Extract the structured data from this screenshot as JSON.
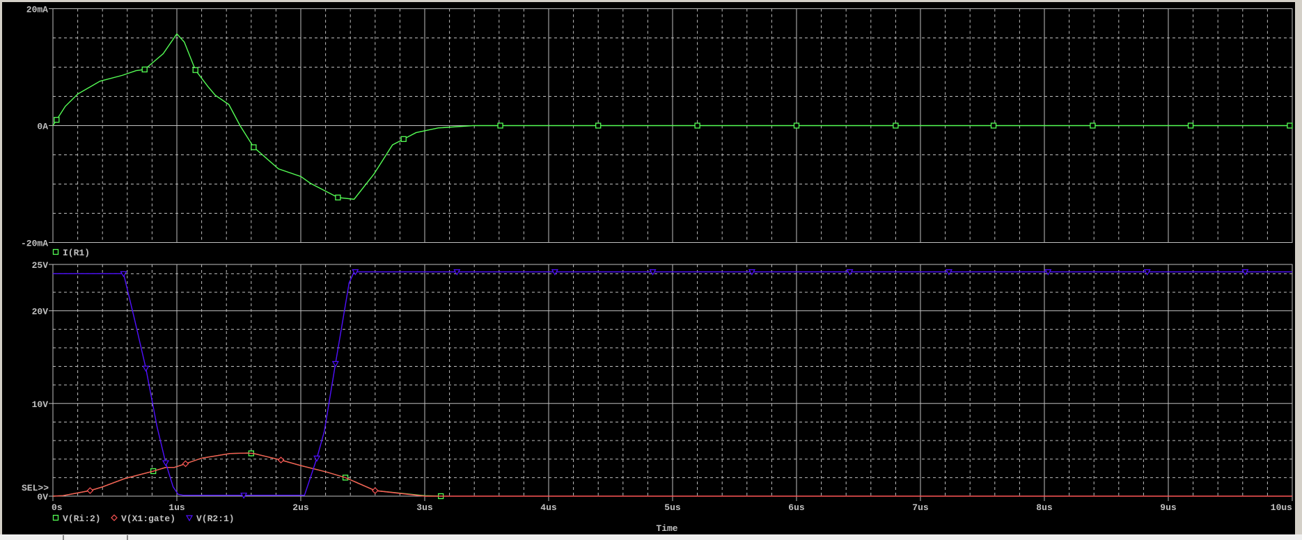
{
  "colors": {
    "background": "#000000",
    "grid": "#c0c0c0",
    "text": "#c0c0c0",
    "green": "#55ff55",
    "red": "#ff5555",
    "blue": "#5010ff"
  },
  "x_axis": {
    "label": "Time",
    "ticks": [
      "0s",
      "1us",
      "2us",
      "3us",
      "4us",
      "5us",
      "6us",
      "7us",
      "8us",
      "9us",
      "10us"
    ],
    "range": [
      0,
      10
    ],
    "unit": "us"
  },
  "chart_data": [
    {
      "type": "line",
      "title": "",
      "ylabel": "",
      "ylim": [
        -20,
        20
      ],
      "ytick_labels": [
        "20mA",
        "0A",
        "-20mA"
      ],
      "ytick_values": [
        20,
        0,
        -20
      ],
      "series": [
        {
          "name": "I(R1)",
          "color": "#55ff55",
          "marker": "square",
          "x": [
            0,
            0.1,
            0.2,
            0.38,
            0.56,
            0.67,
            0.74,
            0.89,
            1.0,
            1.06,
            1.15,
            1.25,
            1.31,
            1.42,
            1.51,
            1.62,
            1.82,
            2.0,
            2.08,
            2.3,
            2.43,
            2.59,
            2.74,
            2.83,
            2.93,
            3.11,
            3.39,
            10
          ],
          "y": [
            0,
            3.3,
            5.4,
            7.6,
            8.6,
            9.4,
            9.6,
            12.3,
            15.7,
            14.3,
            9.5,
            6.7,
            5.2,
            3.6,
            0,
            -3.7,
            -7.4,
            -8.7,
            -9.9,
            -12.3,
            -12.6,
            -8.3,
            -3.3,
            -2.3,
            -1.2,
            -0.4,
            0,
            0
          ],
          "markers_x": [
            0.03,
            0.74,
            1.15,
            1.62,
            2.3,
            2.83,
            3.61,
            4.4,
            5.2,
            6.0,
            6.8,
            7.59,
            8.39,
            9.18,
            9.98
          ]
        }
      ]
    },
    {
      "type": "line",
      "title": "",
      "ylabel": "",
      "ylim": [
        0,
        25
      ],
      "ytick_labels": [
        "25V",
        "20V",
        "10V",
        "0V"
      ],
      "ytick_values": [
        25,
        20,
        10,
        0
      ],
      "annotation": "SEL>>",
      "series": [
        {
          "name": "V(Ri:2)",
          "color": "#55ff55",
          "marker": "square",
          "x": [
            0,
            0.08,
            0.3,
            0.4,
            0.58,
            0.81,
            0.91,
            0.98,
            1.07,
            1.2,
            1.43,
            1.57,
            1.62,
            1.84,
            2.0,
            2.21,
            2.36,
            2.6,
            3.0,
            3.13
          ],
          "y": [
            0,
            0.05,
            0.6,
            1,
            1.9,
            2.7,
            3.1,
            3.1,
            3.5,
            4.1,
            4.6,
            4.65,
            4.6,
            3.9,
            3.3,
            2.6,
            2.0,
            0.6,
            0.05,
            0
          ],
          "markers_x": [
            0.81,
            1.6,
            2.36,
            3.13
          ]
        },
        {
          "name": "V(X1:gate)",
          "color": "#ff5555",
          "marker": "diamond",
          "x": [
            0,
            0.08,
            0.3,
            0.4,
            0.58,
            0.81,
            0.91,
            0.98,
            1.07,
            1.2,
            1.43,
            1.57,
            1.62,
            1.84,
            2.0,
            2.21,
            2.36,
            2.6,
            3.0,
            10
          ],
          "y": [
            0,
            0.05,
            0.6,
            1,
            1.9,
            2.7,
            3.1,
            3.1,
            3.5,
            4.1,
            4.6,
            4.65,
            4.6,
            3.9,
            3.3,
            2.6,
            2.0,
            0.6,
            0,
            0
          ],
          "markers_x": [
            0.3,
            1.07,
            1.84,
            2.6
          ]
        },
        {
          "name": "V(R2:1)",
          "color": "#5010ff",
          "marker": "triangle-down",
          "x": [
            0,
            0.57,
            0.66,
            0.75,
            0.84,
            0.91,
            0.97,
            1.01,
            1.05,
            2.03,
            2.13,
            2.19,
            2.28,
            2.39,
            2.43,
            10
          ],
          "y": [
            24,
            24,
            19,
            13.8,
            7.5,
            3.6,
            1,
            0.2,
            0.1,
            0.1,
            4.1,
            7,
            14.3,
            23,
            24.2,
            24.2
          ],
          "markers_x": [
            0.57,
            0.75,
            0.91,
            1.54,
            2.13,
            2.28,
            2.44,
            3.26,
            4.05,
            4.84,
            5.64,
            6.43,
            7.23,
            8.03,
            8.83,
            9.62
          ]
        }
      ]
    }
  ]
}
